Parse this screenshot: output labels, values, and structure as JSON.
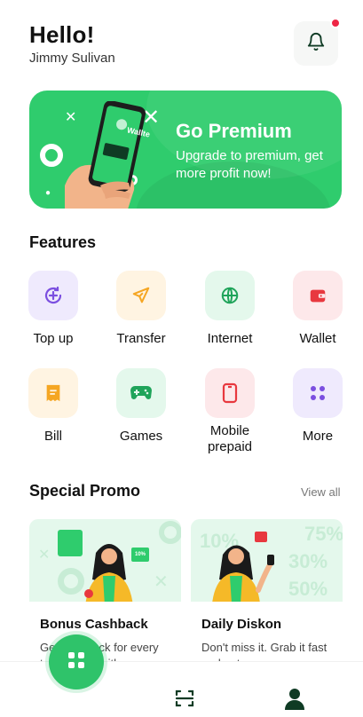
{
  "header": {
    "greeting": "Hello!",
    "user_name": "Jimmy Sulivan"
  },
  "banner": {
    "title": "Go Premium",
    "subtitle": "Upgrade to premium, get more profit now!",
    "phone_brand": "Wallte"
  },
  "features": {
    "title": "Features",
    "items": [
      {
        "label": "Top up",
        "icon": "topup-icon",
        "bg": "#efeafd",
        "color": "#7b4fe0"
      },
      {
        "label": "Transfer",
        "icon": "send-icon",
        "bg": "#fff4e2",
        "color": "#f5a623"
      },
      {
        "label": "Internet",
        "icon": "globe-icon",
        "bg": "#e4f8ec",
        "color": "#1fa45a"
      },
      {
        "label": "Wallet",
        "icon": "wallet-icon",
        "bg": "#fde8ea",
        "color": "#e8383f"
      },
      {
        "label": "Bill",
        "icon": "receipt-icon",
        "bg": "#fff4e2",
        "color": "#f5a623"
      },
      {
        "label": "Games",
        "icon": "gamepad-icon",
        "bg": "#e4f8ec",
        "color": "#1fa45a"
      },
      {
        "label": "Mobile prepaid",
        "icon": "phone-icon",
        "bg": "#fde8ea",
        "color": "#e8383f"
      },
      {
        "label": "More",
        "icon": "grid-icon",
        "bg": "#efeafd",
        "color": "#7b4fe0"
      }
    ]
  },
  "promo": {
    "title": "Special Promo",
    "view_all": "View all",
    "cards": [
      {
        "title": "Bonus Cashback",
        "description": "Get cashback for every transaction with...",
        "badge": "10%"
      },
      {
        "title": "Daily Diskon",
        "description": "Don't miss it. Grab it fast and get...",
        "deco_text": [
          "10%",
          "75%",
          "30%",
          "50%"
        ]
      }
    ]
  },
  "colors": {
    "accent": "#2fcc6d",
    "notification": "#ee2645",
    "dark_green": "#0f3b24"
  }
}
